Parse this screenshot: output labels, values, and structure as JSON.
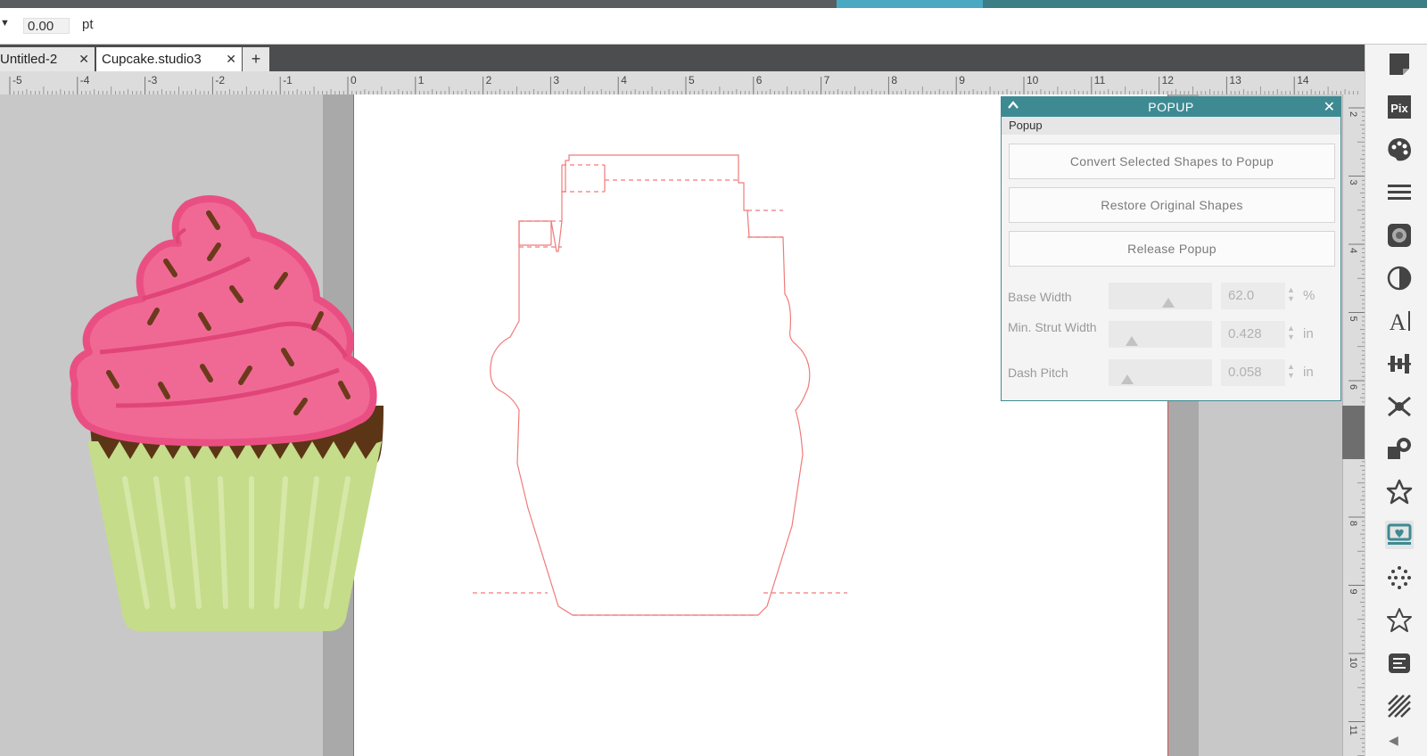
{
  "properties_bar": {
    "stroke_value": "0.00",
    "stroke_unit": "pt"
  },
  "tabs": [
    {
      "label": "Untitled-2",
      "active": false
    },
    {
      "label": "Cupcake.studio3",
      "active": true
    }
  ],
  "tab_add_label": "+",
  "ruler": {
    "horizontal_labels": [
      "-5",
      "-4",
      "-3",
      "-2",
      "-1",
      "0",
      "1",
      "2",
      "3",
      "4",
      "5",
      "6",
      "7",
      "8",
      "9",
      "10",
      "11",
      "12",
      "13",
      "14"
    ],
    "vertical_labels": [
      "2",
      "3",
      "4",
      "5",
      "6",
      "7",
      "8",
      "9",
      "10",
      "11"
    ]
  },
  "popup_panel": {
    "title": "POPUP",
    "collapse_icon": "chevron-up-icon",
    "close_icon": "close-icon",
    "subheader": "Popup",
    "buttons": [
      "Convert Selected Shapes to Popup",
      "Restore Original Shapes",
      "Release Popup"
    ],
    "params": [
      {
        "label": "Base Width",
        "value": "62.0",
        "unit": "%",
        "slider_level": 0.58
      },
      {
        "label": "Min. Strut Width",
        "value": "0.428",
        "unit": "in",
        "slider_level": 0.22
      },
      {
        "label": "Dash Pitch",
        "value": "0.058",
        "unit": "in",
        "slider_level": 0.18
      }
    ]
  },
  "tools": [
    "page-setup-icon",
    "pixscan-icon",
    "fill-palette-icon",
    "line-style-icon",
    "image-effects-icon",
    "transparency-icon",
    "text-style-icon",
    "align-icon",
    "replicate-icon",
    "modify-icon",
    "design-store-icon",
    "popup-icon",
    "offset-icon",
    "sketch-icon",
    "layers-icon",
    "trace-icon"
  ],
  "active_tool": "popup-icon",
  "colors": {
    "accent": "#3e8a93",
    "frosting": "#f06995",
    "frosting_outline": "#ea4f83",
    "cake": "#5c3516",
    "wrapper": "#c5dc8a",
    "cut_line": "#f07a7a"
  }
}
